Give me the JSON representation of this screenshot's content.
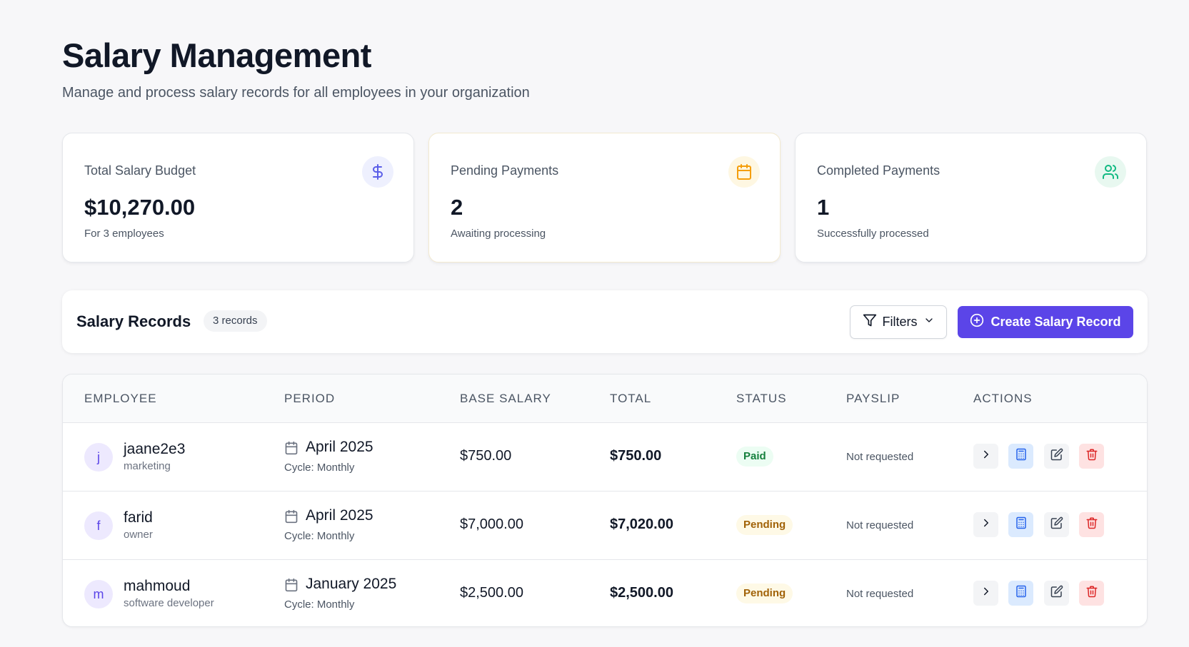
{
  "header": {
    "title": "Salary Management",
    "subtitle": "Manage and process salary records for all employees in your organization"
  },
  "stats": [
    {
      "label": "Total Salary Budget",
      "value": "$10,270.00",
      "sub": "For 3 employees",
      "icon": "dollar-icon"
    },
    {
      "label": "Pending Payments",
      "value": "2",
      "sub": "Awaiting processing",
      "icon": "calendar-icon"
    },
    {
      "label": "Completed Payments",
      "value": "1",
      "sub": "Successfully processed",
      "icon": "users-icon"
    }
  ],
  "records": {
    "title": "Salary Records",
    "badge": "3 records",
    "filters_label": "Filters",
    "create_label": "Create Salary Record"
  },
  "table": {
    "headers": [
      "EMPLOYEE",
      "PERIOD",
      "BASE SALARY",
      "TOTAL",
      "STATUS",
      "PAYSLIP",
      "ACTIONS"
    ],
    "rows": [
      {
        "initial": "j",
        "name": "jaane2e3",
        "role": "marketing",
        "period": "April 2025",
        "cycle": "Cycle: Monthly",
        "base": "$750.00",
        "total": "$750.00",
        "status": "Paid",
        "payslip": "Not requested"
      },
      {
        "initial": "f",
        "name": "farid",
        "role": "owner",
        "period": "April 2025",
        "cycle": "Cycle: Monthly",
        "base": "$7,000.00",
        "total": "$7,020.00",
        "status": "Pending",
        "payslip": "Not requested"
      },
      {
        "initial": "m",
        "name": "mahmoud",
        "role": "software developer",
        "period": "January 2025",
        "cycle": "Cycle: Monthly",
        "base": "$2,500.00",
        "total": "$2,500.00",
        "status": "Pending",
        "payslip": "Not requested"
      }
    ]
  },
  "colors": {
    "accent": "#5b45e8",
    "paid": "#15803d",
    "pending": "#a16207",
    "danger": "#dc2626"
  }
}
